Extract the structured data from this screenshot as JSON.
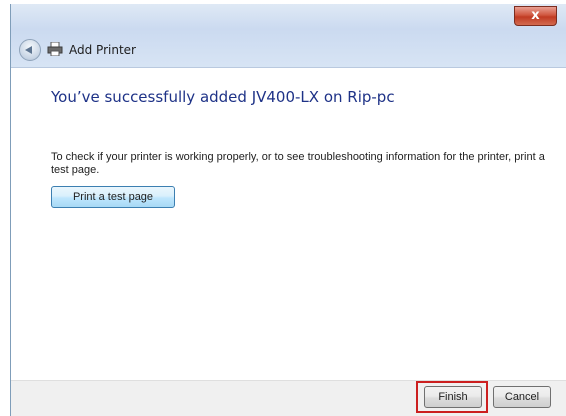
{
  "window": {
    "title": "Add Printer",
    "close_glyph": "x",
    "back_icon": "back-arrow-icon",
    "printer_icon": "printer-icon"
  },
  "main": {
    "headline": "You’ve successfully added JV400-LX on Rip-pc",
    "description": "To check if your printer is working properly, or to see troubleshooting information for the printer, print a test page.",
    "test_button_label": "Print a test page"
  },
  "footer": {
    "finish_label": "Finish",
    "cancel_label": "Cancel",
    "highlight_color": "#cc1f1f"
  }
}
